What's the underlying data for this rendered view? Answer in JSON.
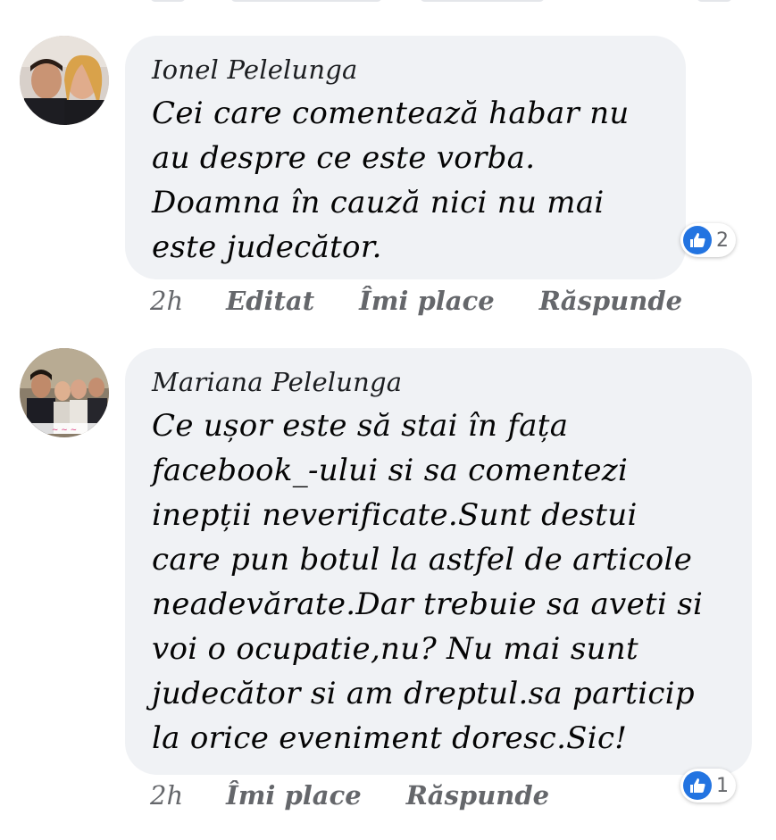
{
  "comments": [
    {
      "author": "Ionel Pelelunga",
      "text": "Cei care comentează habar nu\nau despre ce este vorba.\nDoamna în cauză nici nu mai\neste judecător.",
      "reactions": "2",
      "time": "2h",
      "edited": "Editat",
      "like": "Îmi place",
      "reply": "Răspunde"
    },
    {
      "author": "Mariana Pelelunga",
      "text": "Ce ușor este să stai în fața\nfacebook_-ului si sa comentezi\ninepții neverificate.Sunt destui\ncare pun botul la astfel de articole\nneadevărate.Dar trebuie sa aveti si\nvoi o ocupatie,nu? Nu mai sunt\njudecător si am dreptul.sa particip\nla orice eveniment doresc.Sic!",
      "reactions": "1",
      "time": "2h",
      "like": "Îmi place",
      "reply": "Răspunde"
    }
  ],
  "colors": {
    "bubble": "#f0f2f5",
    "like_blue": "#2374e1",
    "meta_gray": "#65676b"
  },
  "icons": [
    "like-icon",
    "avatar-photo"
  ]
}
